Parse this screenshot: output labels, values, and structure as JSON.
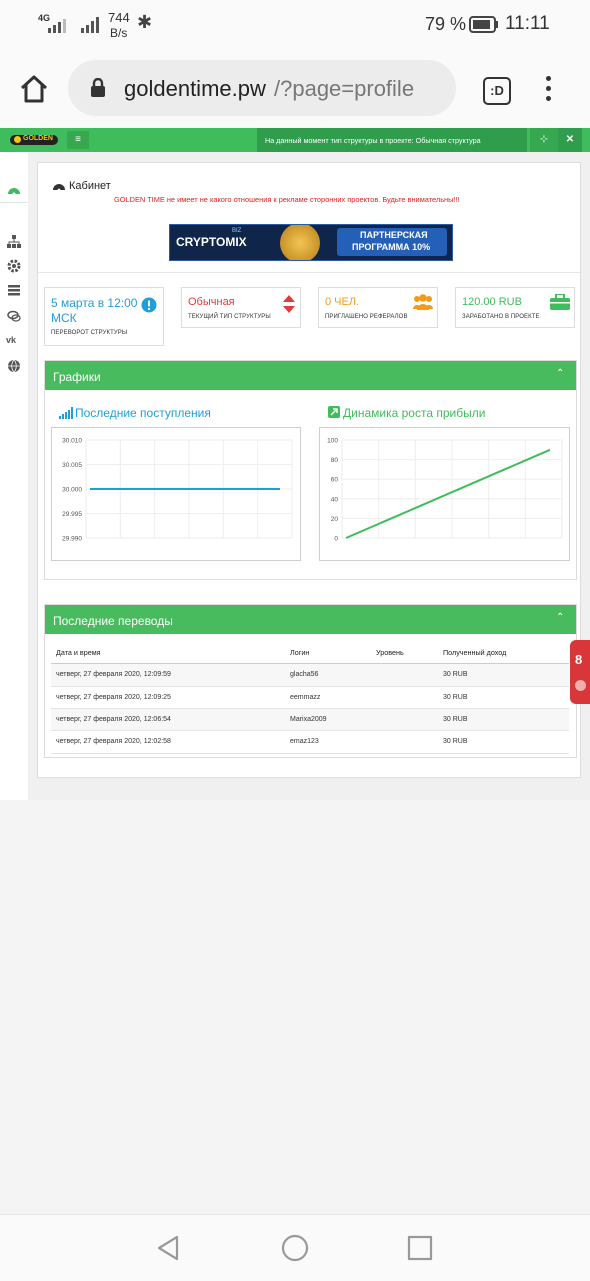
{
  "status_bar": {
    "network": "4G",
    "speed_value": "744",
    "speed_unit": "B/s",
    "battery": "79 %",
    "time": "11:11"
  },
  "browser": {
    "url_domain": "goldentime.pw",
    "url_path": "/?page=profile",
    "tab_count": ":D"
  },
  "site_header": {
    "logo_text": "GOLDEN",
    "menu_icon": "hamburger-icon",
    "notice": "На данный момент тип структуры в проекте: Обычная структура"
  },
  "cabinet": {
    "title": "Кабинет",
    "warning": "GOLDEN TIME не имеет не какого отношения к рекламе сторонних проектов. Будьте внимательны!!!",
    "banner": {
      "brand": "CRYPTOMIX",
      "brand_suffix": "BIZ",
      "promo_line1": "ПАРТНЕРСКАЯ",
      "promo_line2": "ПРОГРАММА 10%"
    }
  },
  "stats": [
    {
      "value": "5 марта в 12:00 МСК",
      "label": "Переворот структуры",
      "color": "#1e9fd8"
    },
    {
      "value": "Обычная",
      "label": "Текущий тип структуры",
      "color": "#e23b3b"
    },
    {
      "value": "0 ЧЕЛ.",
      "label": "Приглашено рефералов",
      "color": "#f39a1c"
    },
    {
      "value": "120.00 RUB",
      "label": "Заработано в проекте",
      "color": "#3fbc5b"
    }
  ],
  "graphs": {
    "header": "Графики",
    "left_title": "Последние поступления",
    "right_title": "Динамика роста прибыли"
  },
  "chart_data": [
    {
      "type": "line",
      "title": "Последние поступления",
      "y_ticks": [
        "30.010",
        "30.005",
        "30.000",
        "29.995",
        "29.990"
      ],
      "ylim": [
        29.99,
        30.01
      ],
      "x": [
        0,
        1,
        2,
        3,
        4,
        5
      ],
      "series": [
        {
          "values": [
            30,
            30,
            30,
            30,
            30,
            30
          ]
        }
      ],
      "color": "#1e9fd8",
      "grid": true
    },
    {
      "type": "line",
      "title": "Динамика роста прибыли",
      "y_ticks": [
        "100",
        "80",
        "60",
        "40",
        "20",
        "0"
      ],
      "ylim": [
        0,
        100
      ],
      "x": [
        0,
        1
      ],
      "series": [
        {
          "values": [
            0,
            90
          ]
        }
      ],
      "color": "#3fbc5b",
      "grid": true
    }
  ],
  "transfers": {
    "header": "Последние переводы",
    "columns": [
      "Дата и время",
      "Логин",
      "Уровень",
      "Полученный доход"
    ],
    "rows": [
      {
        "date": "четверг, 27 февраля 2020, 12:09:59",
        "login": "glacha56",
        "level": "",
        "income": "30 RUB"
      },
      {
        "date": "четверг, 27 февраля 2020, 12:09:25",
        "login": "eemmazz",
        "level": "",
        "income": "30 RUB"
      },
      {
        "date": "четверг, 27 февраля 2020, 12:06:54",
        "login": "Marixa2009",
        "level": "",
        "income": "30 RUB"
      },
      {
        "date": "четверг, 27 февраля 2020, 12:02:58",
        "login": "emaz123",
        "level": "",
        "income": "30 RUB"
      }
    ]
  },
  "side_tab": {
    "label": "8"
  }
}
